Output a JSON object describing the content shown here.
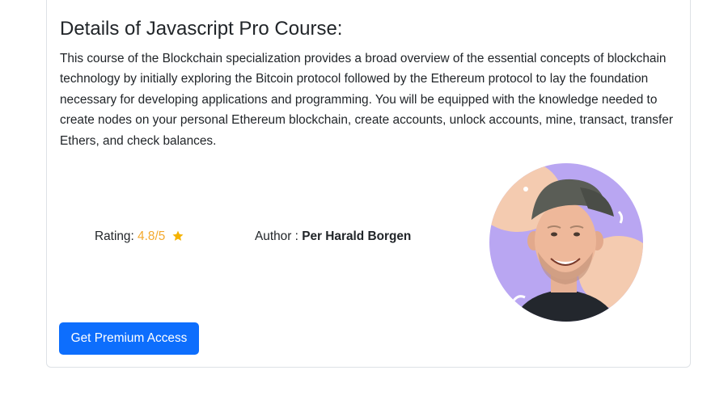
{
  "course": {
    "title": "Details of Javascript Pro Course:",
    "description": "This course of the Blockchain specialization provides a broad overview of the essential concepts of blockchain technology by initially exploring the Bitcoin protocol followed by the Ethereum protocol to lay the foundation necessary for developing applications and programming. You will be equipped with the knowledge needed to create nodes on your personal Ethereum blockchain, create accounts, unlock accounts, mine, transact, transfer Ethers, and check balances.",
    "rating_label": "Rating: ",
    "rating_value": "4.8/5",
    "author_label": "Author : ",
    "author_name": "Per Harald Borgen",
    "cta_label": "Get Premium Access"
  },
  "icons": {
    "rating": "star-icon"
  },
  "colors": {
    "accent": "#f2dd52",
    "rating": "#f4a92e",
    "star": "#f5b301",
    "button": "#0d6efd",
    "avatar_bg": "#b9a6f2"
  }
}
